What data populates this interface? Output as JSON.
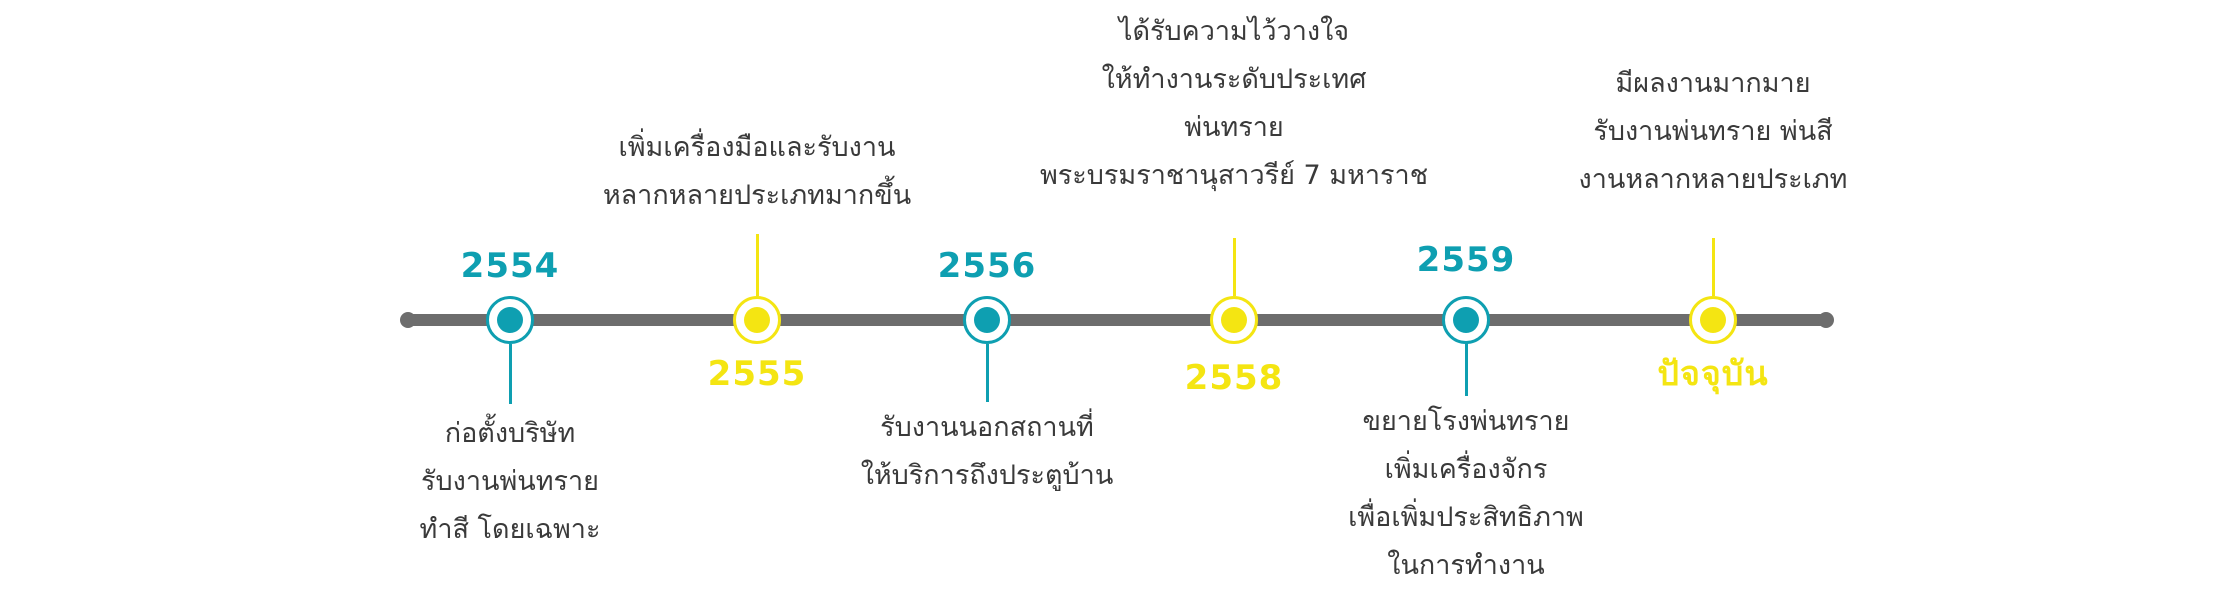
{
  "colors": {
    "axis": "#6d6d6d",
    "teal": "#0e9fb1",
    "yellow": "#f4e512",
    "text": "#3a3a3a"
  },
  "milestones": [
    {
      "year": "2554",
      "color": "teal",
      "position": "below",
      "lines": [
        "ก่อตั้งบริษัท",
        "รับงานพ่นทราย",
        "ทำสี โดยเฉพาะ"
      ]
    },
    {
      "year": "2555",
      "color": "yellow",
      "position": "above",
      "lines": [
        "เพิ่มเครื่องมือและรับงาน",
        "หลากหลายประเภทมากขึ้น"
      ]
    },
    {
      "year": "2556",
      "color": "teal",
      "position": "below",
      "lines": [
        "รับงานนอกสถานที่",
        "ให้บริการถึงประตูบ้าน"
      ]
    },
    {
      "year": "2558",
      "color": "yellow",
      "position": "above",
      "lines": [
        "ได้รับความไว้วางใจ",
        "ให้ทำงานระดับประเทศ",
        "พ่นทราย",
        "พระบรมราชานุสาวรีย์ 7 มหาราช"
      ]
    },
    {
      "year": "2559",
      "color": "teal",
      "position": "below",
      "lines": [
        "ขยายโรงพ่นทราย",
        "เพิ่มเครื่องจักร",
        "เพื่อเพิ่มประสิทธิภาพ",
        "ในการทำงาน"
      ]
    },
    {
      "year": "ปัจจุบัน",
      "color": "yellow",
      "position": "above",
      "lines": [
        "มีผลงานมากมาย",
        "รับงานพ่นทราย พ่นสี",
        "งานหลากหลายประเภท"
      ]
    }
  ]
}
